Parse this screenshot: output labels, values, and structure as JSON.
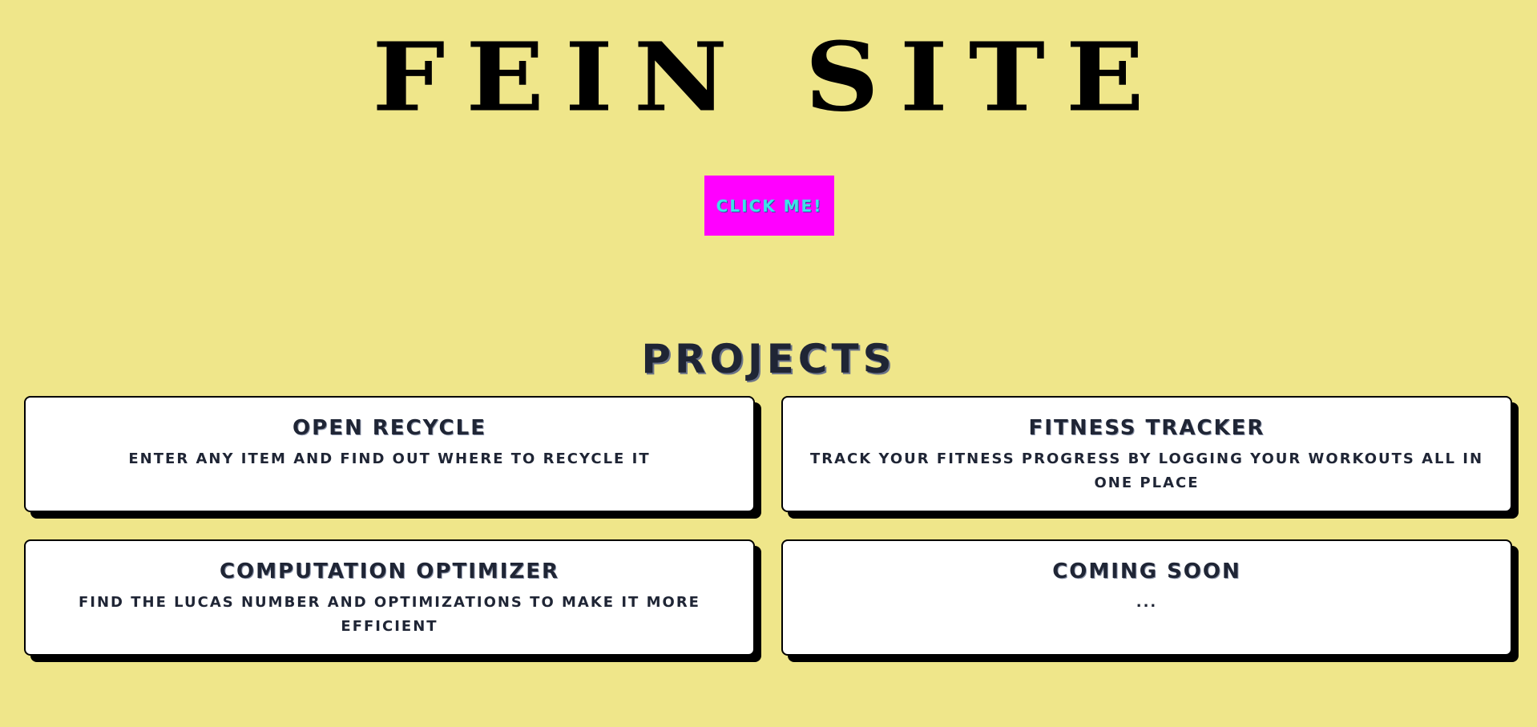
{
  "header": {
    "title": "FEIN SITE",
    "button_label": "CLICK ME!"
  },
  "projects": {
    "heading": "PROJECTS",
    "items": [
      {
        "title": "OPEN RECYCLE",
        "description": "ENTER ANY ITEM AND FIND OUT WHERE TO RECYCLE IT"
      },
      {
        "title": "FITNESS TRACKER",
        "description": "TRACK YOUR FITNESS PROGRESS BY LOGGING YOUR WORKOUTS ALL IN ONE PLACE"
      },
      {
        "title": "COMPUTATION OPTIMIZER",
        "description": "FIND THE LUCAS NUMBER AND OPTIMIZATIONS TO MAKE IT MORE EFFICIENT"
      },
      {
        "title": "COMING SOON",
        "description": "..."
      }
    ]
  },
  "colors": {
    "background": "#EFE68A",
    "button_background": "#FF00FF",
    "button_text": "#40E0E8",
    "card_background": "#FFFFFF",
    "text": "#1F2535"
  }
}
